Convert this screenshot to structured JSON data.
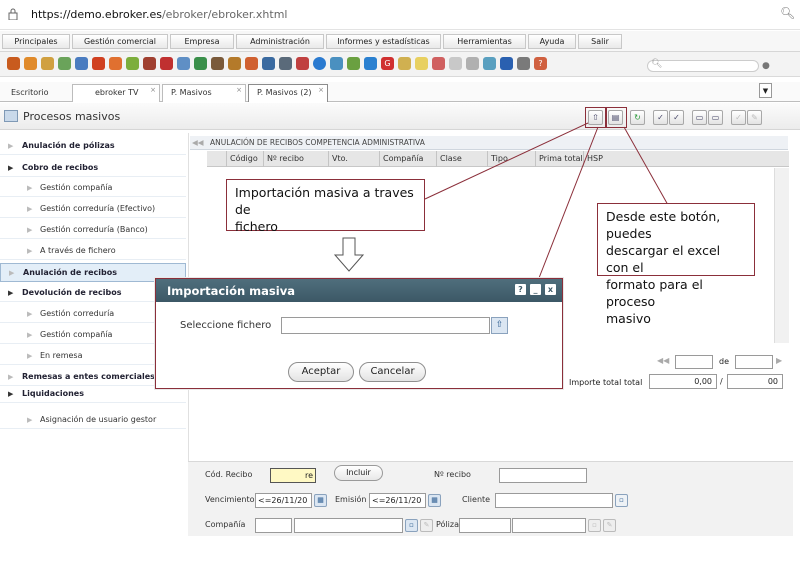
{
  "browser": {
    "url_host": "https://demo.ebroker.es",
    "url_path": "/ebroker/ebroker.xhtml"
  },
  "menu": [
    "Principales",
    "Gestión comercial",
    "Empresa",
    "Administración",
    "Informes y estadísticas",
    "Herramientas",
    "Ayuda",
    "Salir"
  ],
  "tabs": [
    {
      "label": "Escritorio"
    },
    {
      "label": "ebroker TV",
      "close": "×"
    },
    {
      "label": "P. Masivos",
      "close": "×"
    },
    {
      "label": "P. Masivos (2)",
      "close": "×"
    }
  ],
  "page": {
    "title": "Procesos masivos"
  },
  "sidebar": [
    {
      "label": "Anulación de pólizas"
    },
    {
      "label": "Cobro de recibos"
    },
    {
      "label": "Gestión compañía"
    },
    {
      "label": "Gestión correduría (Efectivo)"
    },
    {
      "label": "Gestión correduría (Banco)"
    },
    {
      "label": "A través de fichero"
    },
    {
      "label": "Anulación de recibos"
    },
    {
      "label": "Devolución de recibos"
    },
    {
      "label": "Gestión correduría"
    },
    {
      "label": "Gestión compañía"
    },
    {
      "label": "En remesa"
    },
    {
      "label": "Remesas a entes comerciales"
    },
    {
      "label": "Liquidaciones"
    },
    {
      "label": "Asignación de usuario gestor"
    }
  ],
  "grid": {
    "caption": "ANULACIÓN DE RECIBOS COMPETENCIA ADMINISTRATIVA",
    "columns": [
      "Código",
      "Nº recibo",
      "Vto.",
      "Compañía",
      "Clase",
      "Tipo",
      "Prima total",
      "HSP"
    ],
    "pager_of": "de",
    "total_label": "Importe total",
    "total_label2": "total",
    "total_value": "0,00",
    "total_sep": "/",
    "total_value2": "00"
  },
  "filters": {
    "cod_recibo_label": "Cód. Recibo",
    "cod_recibo_value": "re",
    "incluir": "Incluir",
    "n_recibo_label": "Nº recibo",
    "vencimiento_label": "Vencimiento",
    "vencimiento_value": "<=26/11/20",
    "emision_label": "Emisión",
    "emision_value": "<=26/11/20",
    "cliente_label": "Cliente",
    "compania_label": "Compañía",
    "poliza_label": "Póliza"
  },
  "dialog": {
    "title": "Importación masiva",
    "file_label": "Seleccione fichero",
    "accept": "Aceptar",
    "cancel": "Cancelar",
    "help": "?",
    "minimize": "_",
    "close": "x"
  },
  "callouts": {
    "import_line1": "Importación masiva a traves de",
    "import_line2": "fichero",
    "download_line1": "Desde este botón, puedes",
    "download_line2": "descargar el excel con el",
    "download_line3": "formato para el proceso",
    "download_line4": "masivo"
  },
  "colors": {
    "accent_frame": "#8b2f3a",
    "dialog_header": "#3c5866",
    "selected_row": "#e3eef8"
  }
}
